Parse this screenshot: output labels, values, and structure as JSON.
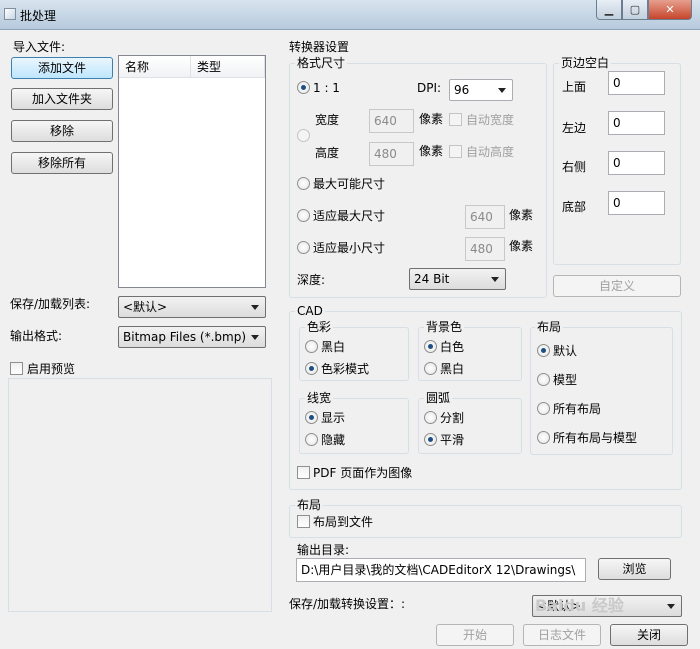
{
  "window": {
    "title": "批处理",
    "minimize": "▁",
    "maximize": "▢",
    "close": "✕"
  },
  "left": {
    "import_label": "导入文件:",
    "buttons": {
      "add_file": "添加文件",
      "add_folder": "加入文件夹",
      "remove": "移除",
      "remove_all": "移除所有"
    },
    "file_list": {
      "columns": [
        "名称",
        "类型"
      ],
      "rows": []
    },
    "save_load_list_label": "保存/加载列表:",
    "save_load_list_value": "<默认>",
    "output_format_label": "输出格式:",
    "output_format_value": "Bitmap Files (*.bmp)",
    "preview_label": "启用预览"
  },
  "converter": {
    "title": "转换器设置",
    "format_size": {
      "title": "格式尺寸",
      "ratio_label": "1 : 1",
      "dpi_label": "DPI:",
      "dpi_value": "96",
      "width_label": "宽度",
      "width_value": "640",
      "height_label": "高度",
      "height_value": "480",
      "pixel_unit": "像素",
      "auto_width": "自动宽度",
      "auto_height": "自动高度",
      "max_possible": "最大可能尺寸",
      "fit_max": "适应最大尺寸",
      "fit_max_value": "640",
      "fit_min": "适应最小尺寸",
      "fit_min_value": "480",
      "depth_label": "深度:",
      "depth_value": "24 Bit"
    },
    "margins": {
      "title": "页边空白",
      "top_label": "上面",
      "top_value": "0",
      "left_label": "左边",
      "left_value": "0",
      "right_label": "右侧",
      "right_value": "0",
      "bottom_label": "底部",
      "bottom_value": "0",
      "custom_button": "自定义"
    },
    "cad": {
      "title": "CAD",
      "color": {
        "title": "色彩",
        "options": [
          "黑白",
          "色彩模式"
        ],
        "selected": "色彩模式"
      },
      "background": {
        "title": "背景色",
        "options": [
          "白色",
          "黑白"
        ],
        "selected": "白色"
      },
      "layout": {
        "title": "布局",
        "options": [
          "默认",
          "模型",
          "所有布局",
          "所有布局与模型"
        ],
        "selected": "默认"
      },
      "lineweight": {
        "title": "线宽",
        "options": [
          "显示",
          "隐藏"
        ],
        "selected": "显示"
      },
      "arc": {
        "title": "圆弧",
        "options": [
          "分割",
          "平滑"
        ],
        "selected": "平滑"
      },
      "pdf_as_image": "PDF 页面作为图像"
    },
    "layout_section": {
      "title": "布局",
      "layout_to_file": "布局到文件"
    },
    "output_dir_label": "输出目录:",
    "output_dir_value": "D:\\用户目录\\我的文档\\CADEditorX 12\\Drawings\\",
    "browse_button": "浏览",
    "save_load_settings_label": "保存/加载转换设置：:",
    "save_load_settings_value": "<默认>"
  },
  "footer": {
    "start": "开始",
    "log": "日志文件",
    "close": "关闭"
  },
  "watermark": "Baidu 经验"
}
